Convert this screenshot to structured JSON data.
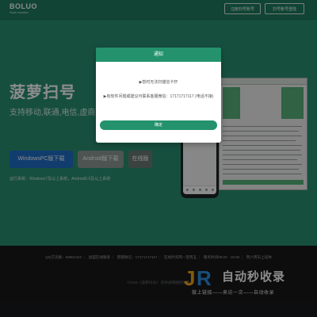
{
  "header": {
    "logo_text": "BOLUO",
    "logo_sub": "Scan number",
    "register_button": "注册扫号账号",
    "login_button": "扫号账号登陆"
  },
  "hero": {
    "title": "菠萝扫号",
    "subtitle": "支持移动,联通,电信,虚商扫号",
    "windows_download": "WindowsPC版下载",
    "android_download": "Android版下载",
    "online_version": "在线版",
    "requirements": "运行系统：Windows7及以上系统，Android5.0及以上系统"
  },
  "footer": {
    "links": [
      "QQ交流群：58801243",
      "加盟在线联系",
      "客服微信：17171717117",
      "在线时间周一至周五",
      "服务时间09:00 - 18:00",
      "周六周日上班休"
    ],
    "copyright": "©2025《菠萝扫号》 软件通用版权所有"
  },
  "watermark": {
    "logo_letters": "JR",
    "text": "自动秒收录",
    "sub": "做上链接——来访一次——自动收录"
  },
  "modal": {
    "title": "通知",
    "line1": "▶暂时无法扫描信卡轩",
    "line2": "▶有软件问题或建议可联系客服微信：17171717117 (电话不接)",
    "ok_button": "确定"
  },
  "colors": {
    "hero_bg": "#2b9173",
    "primary_blue": "#1f6fc8",
    "android_grey": "#8d9a95",
    "online_grey": "#6c7a75",
    "modal_accent": "#23926d"
  }
}
